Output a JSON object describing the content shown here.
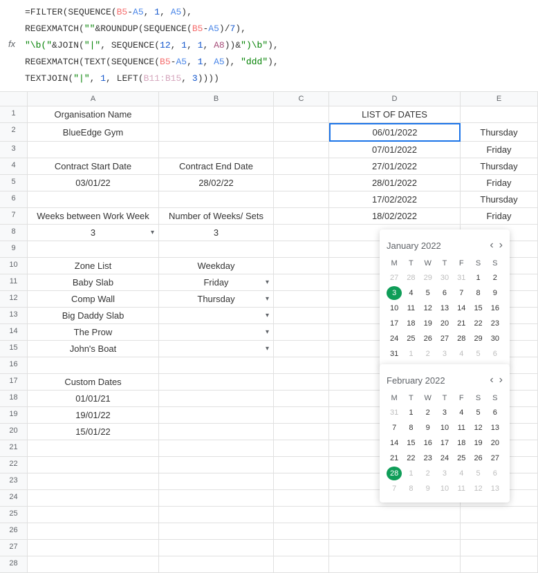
{
  "formula": {
    "line1_prefix": "=FILTER(SEQUENCE(",
    "line1_ref1": "B5",
    "line1_dash": "-",
    "line1_ref2": "A5",
    "line1_mid": ", ",
    "line1_num": "1",
    "line1_mid2": ", ",
    "line1_ref3": "A5",
    "line1_end": "),",
    "line2_prefix": "REGEXMATCH(",
    "line2_str1": "\"\"",
    "line2_amp": "&ROUNDUP(SEQUENCE(",
    "line2_ref1": "B5",
    "line2_dash": "-",
    "line2_ref2": "A5",
    "line2_mid": ")/",
    "line2_num": "7",
    "line2_end": "),",
    "line3_str1": "\"\\b(\"",
    "line3_mid": "&JOIN(",
    "line3_str2": "\"|\"",
    "line3_mid2": ", SEQUENCE(",
    "line3_num1": "12",
    "line3_c": ", ",
    "line3_num2": "1",
    "line3_c2": ", ",
    "line3_num3": "1",
    "line3_c3": ", ",
    "line3_ref": "A8",
    "line3_end": "))&",
    "line3_str3": "\")\\b\"",
    "line3_end2": "),",
    "line4_prefix": "REGEXMATCH(TEXT(SEQUENCE(",
    "line4_ref1": "B5",
    "line4_dash": "-",
    "line4_ref2": "A5",
    "line4_c": ", ",
    "line4_num": "1",
    "line4_c2": ", ",
    "line4_ref3": "A5",
    "line4_end": "), ",
    "line4_str": "\"ddd\"",
    "line4_end2": "),",
    "line5_prefix": "TEXTJOIN(",
    "line5_str": "\"|\"",
    "line5_c": ", ",
    "line5_num": "1",
    "line5_c2": ", LEFT(",
    "line5_ref": "B11:B15",
    "line5_c3": ", ",
    "line5_num2": "3",
    "line5_end": "))))"
  },
  "columns": [
    "A",
    "B",
    "C",
    "D",
    "E"
  ],
  "rows": [
    "1",
    "2",
    "3",
    "4",
    "5",
    "6",
    "7",
    "8",
    "9",
    "10",
    "11",
    "12",
    "13",
    "14",
    "15",
    "16",
    "17",
    "18",
    "19",
    "20",
    "21",
    "22",
    "23",
    "24",
    "25",
    "26",
    "27",
    "28"
  ],
  "grid": {
    "A1": "Organisation Name",
    "A2": "BlueEdge Gym",
    "A4": "Contract Start Date",
    "B4": "Contract End Date",
    "A5": "03/01/22",
    "B5": "28/02/22",
    "A7": "Weeks between Work Week",
    "B7": "Number of Weeks/ Sets",
    "A8": "3",
    "B8": "3",
    "A10": "Zone List",
    "B10": "Weekday",
    "A11": "Baby Slab",
    "B11": "Friday",
    "A12": "Comp Wall",
    "B12": "Thursday",
    "A13": "Big Daddy Slab",
    "A14": "The Prow",
    "A15": "John's Boat",
    "A17": "Custom Dates",
    "A18": "01/01/21",
    "A19": "19/01/22",
    "A20": "15/01/22",
    "D1": "LIST OF DATES",
    "D2": "06/01/2022",
    "E2": "Thursday",
    "D3": "07/01/2022",
    "E3": "Friday",
    "D4": "27/01/2022",
    "E4": "Thursday",
    "D5": "28/01/2022",
    "E5": "Friday",
    "D6": "17/02/2022",
    "E6": "Thursday",
    "D7": "18/02/2022",
    "E7": "Friday"
  },
  "cal1": {
    "title": "January 2022",
    "dayh": [
      "M",
      "T",
      "W",
      "T",
      "F",
      "S",
      "S"
    ],
    "days": [
      {
        "d": "27",
        "o": true
      },
      {
        "d": "28",
        "o": true
      },
      {
        "d": "29",
        "o": true
      },
      {
        "d": "30",
        "o": true
      },
      {
        "d": "31",
        "o": true
      },
      {
        "d": "1"
      },
      {
        "d": "2"
      },
      {
        "d": "3",
        "sel": true
      },
      {
        "d": "4"
      },
      {
        "d": "5"
      },
      {
        "d": "6"
      },
      {
        "d": "7"
      },
      {
        "d": "8"
      },
      {
        "d": "9"
      },
      {
        "d": "10"
      },
      {
        "d": "11"
      },
      {
        "d": "12"
      },
      {
        "d": "13"
      },
      {
        "d": "14"
      },
      {
        "d": "15"
      },
      {
        "d": "16"
      },
      {
        "d": "17"
      },
      {
        "d": "18"
      },
      {
        "d": "19"
      },
      {
        "d": "20"
      },
      {
        "d": "21"
      },
      {
        "d": "22"
      },
      {
        "d": "23"
      },
      {
        "d": "24"
      },
      {
        "d": "25"
      },
      {
        "d": "26"
      },
      {
        "d": "27"
      },
      {
        "d": "28"
      },
      {
        "d": "29"
      },
      {
        "d": "30"
      },
      {
        "d": "31"
      },
      {
        "d": "1",
        "o": true
      },
      {
        "d": "2",
        "o": true
      },
      {
        "d": "3",
        "o": true
      },
      {
        "d": "4",
        "o": true
      },
      {
        "d": "5",
        "o": true
      },
      {
        "d": "6",
        "o": true
      }
    ]
  },
  "cal2": {
    "title": "February 2022",
    "dayh": [
      "M",
      "T",
      "W",
      "T",
      "F",
      "S",
      "S"
    ],
    "days": [
      {
        "d": "31",
        "o": true
      },
      {
        "d": "1"
      },
      {
        "d": "2"
      },
      {
        "d": "3"
      },
      {
        "d": "4"
      },
      {
        "d": "5"
      },
      {
        "d": "6"
      },
      {
        "d": "7"
      },
      {
        "d": "8"
      },
      {
        "d": "9"
      },
      {
        "d": "10"
      },
      {
        "d": "11"
      },
      {
        "d": "12"
      },
      {
        "d": "13"
      },
      {
        "d": "14"
      },
      {
        "d": "15"
      },
      {
        "d": "16"
      },
      {
        "d": "17"
      },
      {
        "d": "18"
      },
      {
        "d": "19"
      },
      {
        "d": "20"
      },
      {
        "d": "21"
      },
      {
        "d": "22"
      },
      {
        "d": "23"
      },
      {
        "d": "24"
      },
      {
        "d": "25"
      },
      {
        "d": "26"
      },
      {
        "d": "27"
      },
      {
        "d": "28",
        "sel": true
      },
      {
        "d": "1",
        "o": true
      },
      {
        "d": "2",
        "o": true
      },
      {
        "d": "3",
        "o": true
      },
      {
        "d": "4",
        "o": true
      },
      {
        "d": "5",
        "o": true
      },
      {
        "d": "6",
        "o": true
      },
      {
        "d": "7",
        "o": true
      },
      {
        "d": "8",
        "o": true
      },
      {
        "d": "9",
        "o": true
      },
      {
        "d": "10",
        "o": true
      },
      {
        "d": "11",
        "o": true
      },
      {
        "d": "12",
        "o": true
      },
      {
        "d": "13",
        "o": true
      }
    ]
  },
  "dropdown_arrow": "▾",
  "nav_prev": "‹",
  "nav_next": "›"
}
